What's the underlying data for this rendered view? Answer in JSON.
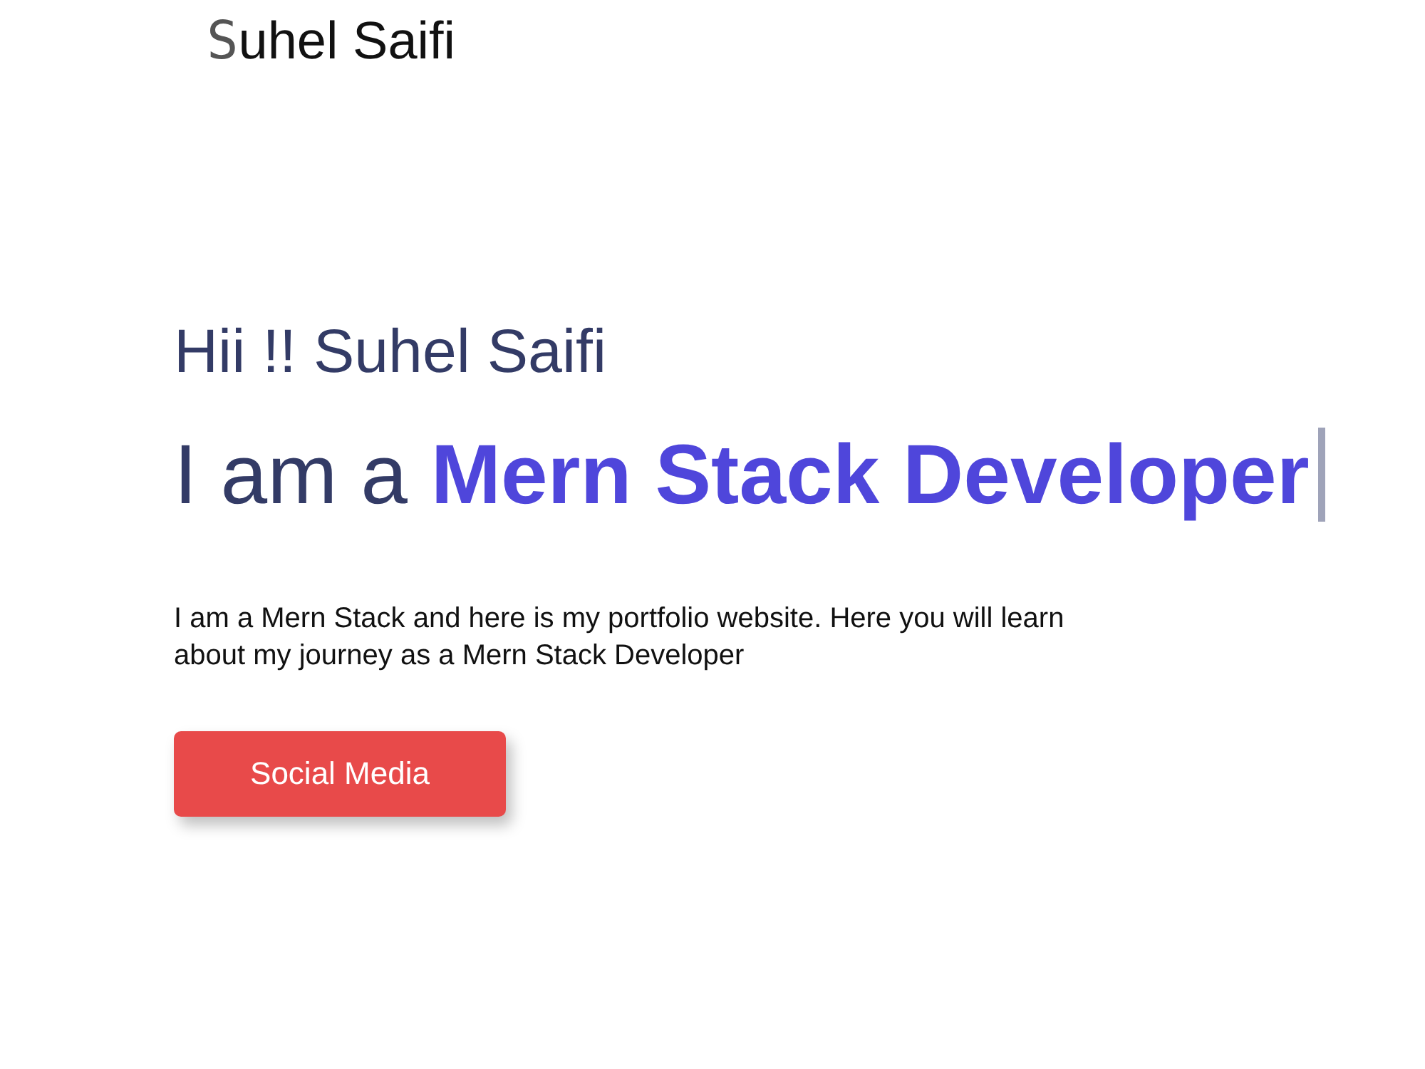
{
  "header": {
    "logo": "Suhel Saifi"
  },
  "hero": {
    "greeting": "Hii !! Suhel Saifi",
    "headline": "I am a **Mern Stack Developer**",
    "typing_cursor": true,
    "description": "I am a Mern Stack and here is my portfolio website. Here you will learn about my journey as a Mern Stack Developer",
    "button": "Social Media"
  }
}
